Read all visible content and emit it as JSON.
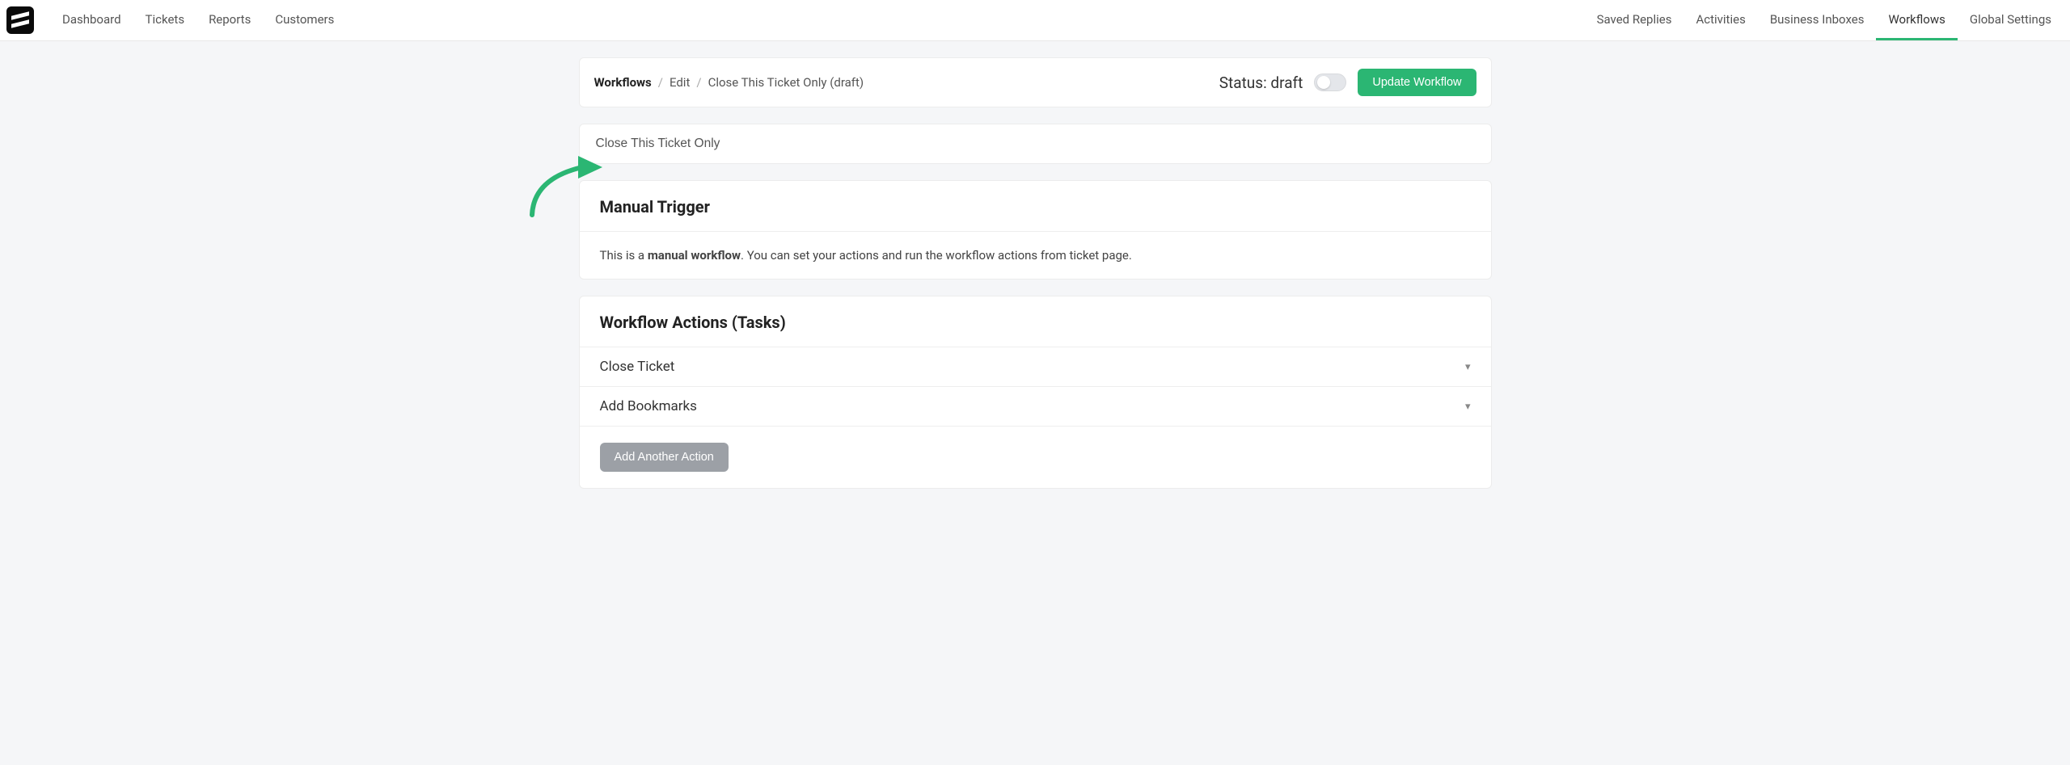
{
  "nav": {
    "left": [
      "Dashboard",
      "Tickets",
      "Reports",
      "Customers"
    ],
    "right": [
      "Saved Replies",
      "Activities",
      "Business Inboxes",
      "Workflows",
      "Global Settings"
    ],
    "active": "Workflows"
  },
  "breadcrumbs": {
    "root": "Workflows",
    "mid": "Edit",
    "leaf": "Close This Ticket Only (draft)"
  },
  "status": {
    "label": "Status:",
    "value": "draft"
  },
  "buttons": {
    "update": "Update Workflow",
    "add_action": "Add Another Action"
  },
  "name_input": {
    "value": "Close This Ticket Only"
  },
  "trigger": {
    "title": "Manual Trigger",
    "desc_prefix": "This is a ",
    "desc_strong": "manual workflow",
    "desc_suffix": ". You can set your actions and run the workflow actions from ticket page."
  },
  "actions_section": {
    "title": "Workflow Actions (Tasks)",
    "items": [
      "Close Ticket",
      "Add Bookmarks"
    ]
  },
  "colors": {
    "accent": "#2bb673",
    "bg": "#f5f6f8"
  }
}
